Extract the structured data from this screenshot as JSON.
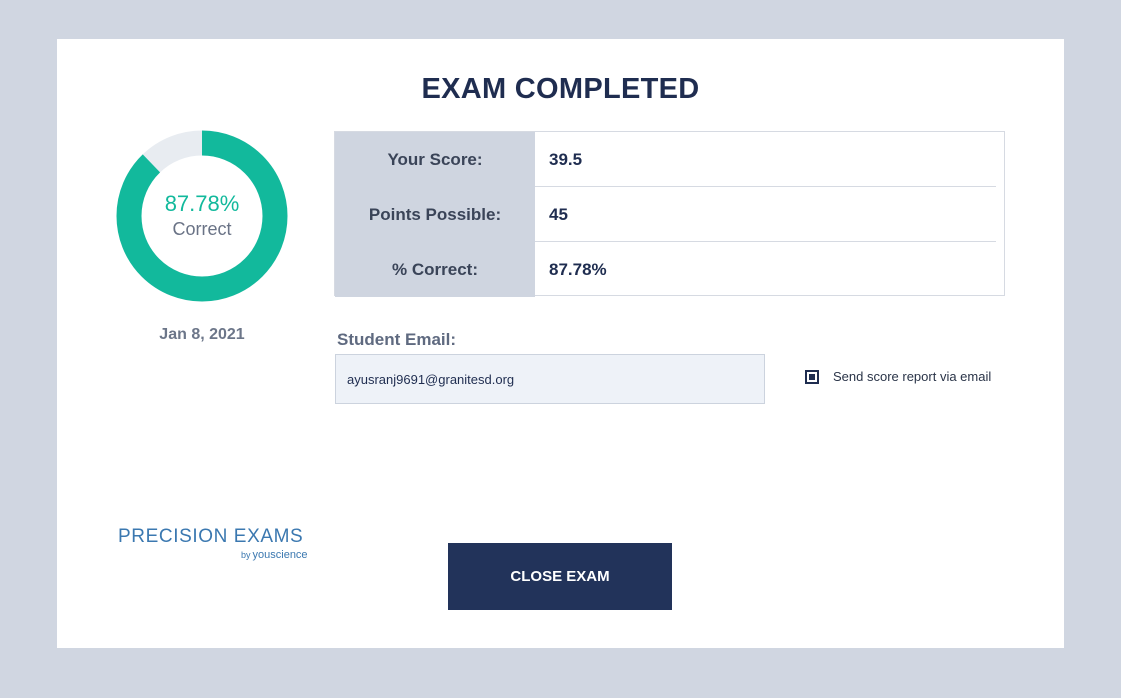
{
  "title": "EXAM COMPLETED",
  "result": {
    "percent_value": 87.78,
    "percent_text": "87.78%",
    "percent_caption": "Correct",
    "date": "Jan 8, 2021"
  },
  "score_table": [
    {
      "label": "Your Score:",
      "value": "39.5"
    },
    {
      "label": "Points Possible:",
      "value": "45"
    },
    {
      "label": "% Correct:",
      "value": "87.78%"
    }
  ],
  "email": {
    "label": "Student Email:",
    "value": "ayusranj9691@granitesd.org"
  },
  "send_report": {
    "label": "Send score report via email",
    "checked": true
  },
  "logo": {
    "main": "PRECISION EXAMS",
    "by": "by",
    "brand": "youscience"
  },
  "close_button": "CLOSE EXAM",
  "colors": {
    "accent": "#12b99c",
    "ring_track": "#e8ecf1",
    "navy": "#22335a",
    "background": "#d0d6e1"
  }
}
